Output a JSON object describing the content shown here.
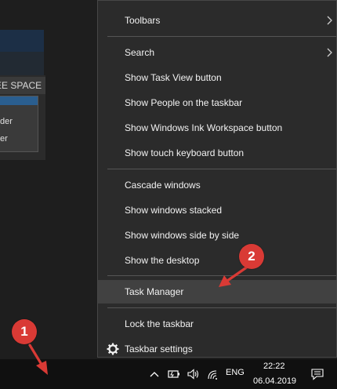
{
  "background": {
    "free_space_label": "EE SPACE",
    "dropdown_options": [
      "der",
      "er"
    ]
  },
  "context_menu": {
    "items": [
      {
        "label": "Toolbars",
        "submenu": true
      },
      {
        "label": "Search",
        "submenu": true
      },
      {
        "label": "Show Task View button"
      },
      {
        "label": "Show People on the taskbar"
      },
      {
        "label": "Show Windows Ink Workspace button"
      },
      {
        "label": "Show touch keyboard button"
      },
      {
        "label": "Cascade windows"
      },
      {
        "label": "Show windows stacked"
      },
      {
        "label": "Show windows side by side"
      },
      {
        "label": "Show the desktop"
      },
      {
        "label": "Task Manager",
        "highlighted": true
      },
      {
        "label": "Lock the taskbar"
      },
      {
        "label": "Taskbar settings",
        "icon": "gear-icon"
      }
    ]
  },
  "taskbar": {
    "language": "ENG",
    "time": "22:22",
    "date": "06.04.2019",
    "tray_icons": [
      "chevron-up-icon",
      "battery-icon",
      "volume-icon",
      "wifi-icon",
      "action-center-icon"
    ]
  },
  "annotations": {
    "step1": "1",
    "step2": "2",
    "accent": "#d93a35"
  }
}
